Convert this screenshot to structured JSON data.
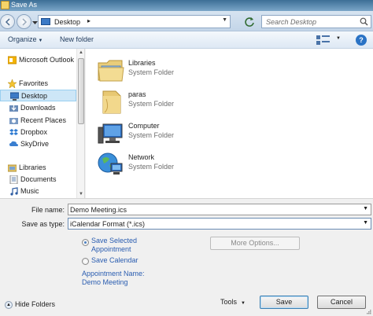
{
  "window": {
    "title": "Save As"
  },
  "address": {
    "location": "Desktop",
    "search_placeholder": "Search Desktop"
  },
  "toolbar": {
    "organize_label": "Organize",
    "new_folder_label": "New folder"
  },
  "nav": {
    "items": [
      {
        "label": "Microsoft Outlook",
        "icon": "outlook-icon"
      },
      {
        "label": "Favorites",
        "icon": "star-icon"
      },
      {
        "label": "Desktop",
        "icon": "desktop-icon"
      },
      {
        "label": "Downloads",
        "icon": "downloads-icon"
      },
      {
        "label": "Recent Places",
        "icon": "recent-places-icon"
      },
      {
        "label": "Dropbox",
        "icon": "dropbox-icon"
      },
      {
        "label": "SkyDrive",
        "icon": "skydrive-icon"
      },
      {
        "label": "Libraries",
        "icon": "libraries-icon"
      },
      {
        "label": "Documents",
        "icon": "documents-icon"
      },
      {
        "label": "Music",
        "icon": "music-icon"
      }
    ]
  },
  "files": [
    {
      "name": "Libraries",
      "type": "System Folder",
      "icon": "libraries-folder-icon"
    },
    {
      "name": "paras",
      "type": "System Folder",
      "icon": "user-folder-icon"
    },
    {
      "name": "Computer",
      "type": "System Folder",
      "icon": "computer-icon"
    },
    {
      "name": "Network",
      "type": "System Folder",
      "icon": "network-icon"
    }
  ],
  "form": {
    "file_name_label": "File name:",
    "file_name_value": "Demo Meeting.ics",
    "save_as_type_label": "Save as type:",
    "save_as_type_value": "iCalendar Format (*.ics)",
    "option_selected_label_1": "Save Selected",
    "option_selected_label_2": "Appointment",
    "option_calendar_label": "Save Calendar",
    "more_options_label": "More Options...",
    "appointment_name_label": "Appointment Name:",
    "appointment_name_value": "Demo Meeting"
  },
  "footer": {
    "hide_folders_label": "Hide Folders",
    "tools_label": "Tools",
    "save_label": "Save",
    "cancel_label": "Cancel"
  }
}
